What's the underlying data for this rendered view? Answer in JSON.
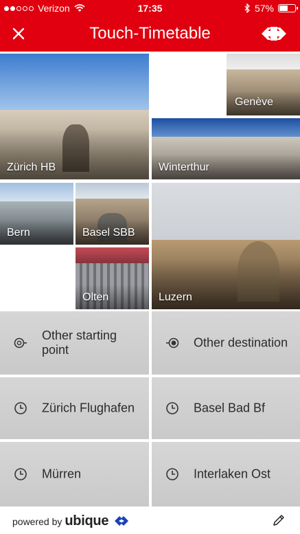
{
  "status_bar": {
    "carrier": "Verizon",
    "time": "17:35",
    "battery": "57%",
    "battery_level": 0.57,
    "signal_bars_filled": 2,
    "signal_bars_total": 5
  },
  "header": {
    "title": "Touch-Timetable",
    "background_color": "#e0000f",
    "close_icon": "close-icon",
    "logo_icon": "sbb-logo-icon"
  },
  "stations": [
    {
      "label": "Zürich HB"
    },
    {
      "label": "Genève"
    },
    {
      "label": "Winterthur"
    },
    {
      "label": "Bern"
    },
    {
      "label": "Basel SBB"
    },
    {
      "label": "Olten"
    },
    {
      "label": "Luzern"
    }
  ],
  "quick_buttons": [
    {
      "label": "Other starting point",
      "icon": "origin-icon"
    },
    {
      "label": "Other destination",
      "icon": "destination-icon"
    },
    {
      "label": "Zürich Flughafen",
      "icon": "clock-icon"
    },
    {
      "label": "Basel Bad Bf",
      "icon": "clock-icon"
    },
    {
      "label": "Mürren",
      "icon": "clock-icon"
    },
    {
      "label": "Interlaken Ost",
      "icon": "clock-icon"
    }
  ],
  "footer": {
    "powered_by": "powered by",
    "brand": "ubique",
    "edit_icon": "pencil-icon"
  }
}
